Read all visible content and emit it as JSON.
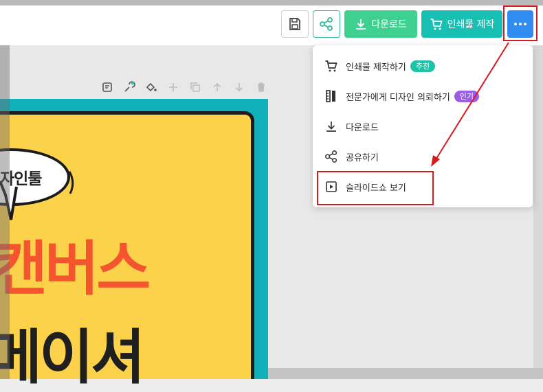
{
  "toolbar": {
    "save_icon": "save-icon",
    "share_icon": "share-icon",
    "download_label": "다운로드",
    "print_label": "인쇄물 제작",
    "more_icon": "more-icon",
    "colors": {
      "download": "#3dd08f",
      "print": "#17c0b3",
      "more": "#2f8cf0",
      "share": "#2fb99b"
    }
  },
  "edit_tools": [
    "note-icon",
    "ai-brush-icon",
    "fill-icon",
    "add-icon",
    "copy-icon",
    "up-icon",
    "down-icon",
    "delete-icon"
  ],
  "design": {
    "bubble_text": "자인툴",
    "headline_line1": "캔버스",
    "headline_line2": "메이셔"
  },
  "menu": {
    "items": [
      {
        "label": "인쇄물 제작하기",
        "badge": "추천",
        "icon": "cart-icon"
      },
      {
        "label": "전문가에게 디자인 의뢰하기",
        "badge": "인기",
        "icon": "ruler-icon"
      },
      {
        "label": "다운로드",
        "icon": "download-icon"
      },
      {
        "label": "공유하기",
        "icon": "share-icon"
      },
      {
        "label": "슬라이드쇼 보기",
        "icon": "play-icon"
      }
    ]
  },
  "highlight_color": "#d8191c"
}
